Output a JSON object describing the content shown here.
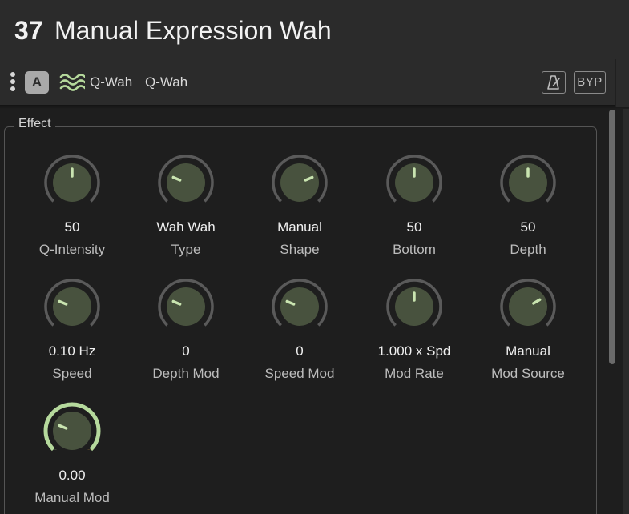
{
  "header": {
    "slot_number": "37",
    "title": "Manual Expression Wah"
  },
  "toolbar": {
    "slot_letter": "A",
    "model_category": "Q-Wah",
    "model_name": "Q-Wah",
    "bypass_label": "BYP",
    "wah_icon_color": "#b5d99c"
  },
  "group": {
    "label": "Effect"
  },
  "knobs": [
    {
      "label": "Q-Intensity",
      "value": "50",
      "position": 0.5
    },
    {
      "label": "Type",
      "value": "Wah Wah",
      "position": 0.25
    },
    {
      "label": "Shape",
      "value": "Manual",
      "position": 0.75
    },
    {
      "label": "Bottom",
      "value": "50",
      "position": 0.5
    },
    {
      "label": "Depth",
      "value": "50",
      "position": 0.5
    },
    {
      "label": "Speed",
      "value": "0.10 Hz",
      "position": 0.25
    },
    {
      "label": "Depth Mod",
      "value": "0",
      "position": 0.25
    },
    {
      "label": "Speed Mod",
      "value": "0",
      "position": 0.25
    },
    {
      "label": "Mod Rate",
      "value": "1.000 x Spd",
      "position": 0.5
    },
    {
      "label": "Mod Source",
      "value": "Manual",
      "position": 0.72
    },
    {
      "label": "Manual Mod",
      "value": "0.00",
      "position": 0.25,
      "active": true
    }
  ],
  "colors": {
    "knob_face": "#48523e",
    "knob_pointer": "#c9e4b0",
    "knob_arc": "#5a5a5a",
    "knob_arc_active": "#b5d99c",
    "mod_marker": "#e8b04a"
  }
}
